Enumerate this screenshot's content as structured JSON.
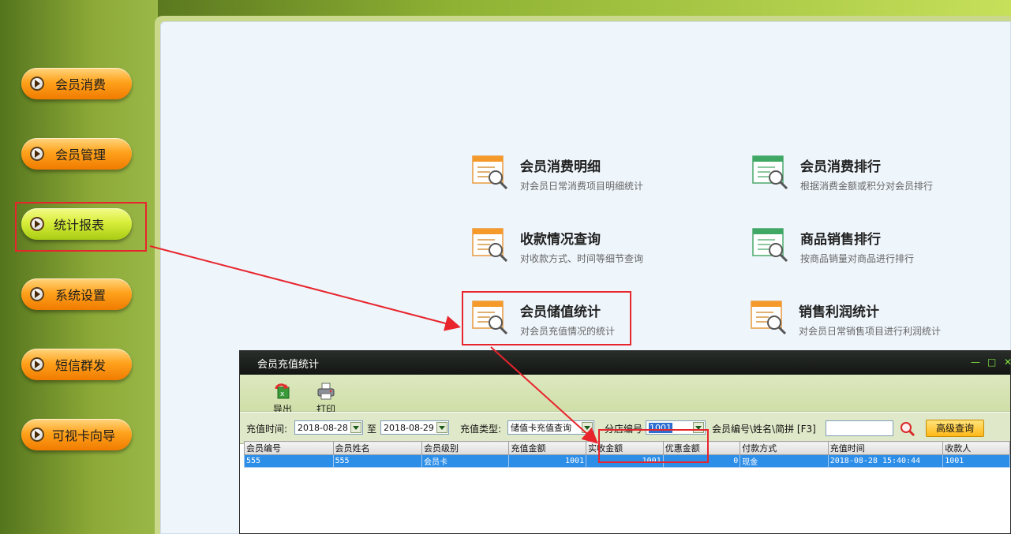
{
  "sidebar": {
    "items": [
      {
        "label": "会员消费"
      },
      {
        "label": "会员管理"
      },
      {
        "label": "统计报表"
      },
      {
        "label": "系统设置"
      },
      {
        "label": "短信群发"
      },
      {
        "label": "可视卡向导"
      }
    ]
  },
  "reports": [
    {
      "title": "会员消费明细",
      "desc": "对会员日常消费项目明细统计"
    },
    {
      "title": "会员消费排行",
      "desc": "根据消费金额或积分对会员排行"
    },
    {
      "title": "收款情况查询",
      "desc": "对收款方式、时间等细节查询"
    },
    {
      "title": "商品销售排行",
      "desc": "按商品销量对商品进行排行"
    },
    {
      "title": "会员储值统计",
      "desc": "对会员充值情况的统计"
    },
    {
      "title": "销售利润统计",
      "desc": "对会员日常销售项目进行利润统计"
    }
  ],
  "window": {
    "title": "会员充值统计",
    "toolbar": {
      "export": "导出",
      "print": "打印"
    },
    "filter": {
      "time_label": "充值时间:",
      "date_from": "2018-08-28",
      "to_label": "至",
      "date_to": "2018-08-29",
      "type_label": "充值类型:",
      "type_value": "储值卡充值查询",
      "branch_label": "分店编号",
      "branch_value": "1001",
      "search_label": "会员编号\\姓名\\简拼 [F3]",
      "search_value": "",
      "advanced_button": "高级查询"
    },
    "table": {
      "headers": [
        "会员编号",
        "会员姓名",
        "会员级别",
        "充值金额",
        "实收金额",
        "优惠金额",
        "付款方式",
        "充值时间",
        "收款人"
      ],
      "rows": [
        [
          "555",
          "555",
          "会员卡",
          "1001",
          "1001",
          "0",
          "现金",
          "2018-08-28 15:40:44",
          "1001"
        ]
      ]
    }
  },
  "colors": {
    "highlight": "#e8242c",
    "selected_row": "#2d8ee8"
  }
}
